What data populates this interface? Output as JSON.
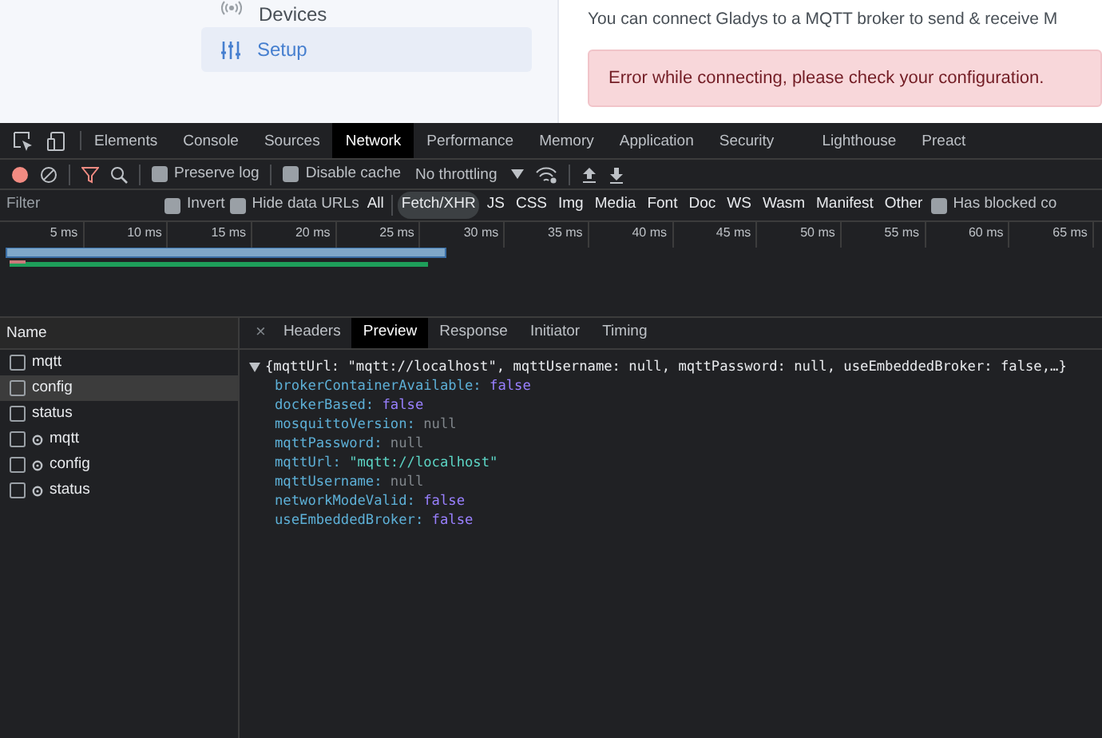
{
  "app": {
    "sidebar": [
      {
        "label": "Devices",
        "selected": false
      },
      {
        "label": "Setup",
        "selected": true
      }
    ],
    "intro": "You can connect Gladys to a MQTT broker to send & receive M",
    "alert": "Error while connecting, please check your configuration."
  },
  "devtools": {
    "tabs": [
      {
        "label": "Elements",
        "selected": false
      },
      {
        "label": "Console",
        "selected": false
      },
      {
        "label": "Sources",
        "selected": false
      },
      {
        "label": "Network",
        "selected": true
      },
      {
        "label": "Performance",
        "selected": false
      },
      {
        "label": "Memory",
        "selected": false
      },
      {
        "label": "Application",
        "selected": false
      },
      {
        "label": "Security",
        "selected": false
      },
      {
        "label": "Lighthouse",
        "selected": false
      },
      {
        "label": "Preact",
        "selected": false
      }
    ],
    "toolbar": {
      "preserve_log": {
        "label": "Preserve log",
        "checked": false
      },
      "disable_cache": {
        "label": "Disable cache",
        "checked": false
      },
      "throttling": "No throttling",
      "filter_on": true
    },
    "filter": {
      "placeholder": "Filter",
      "invert": {
        "label": "Invert",
        "checked": false
      },
      "hide_data_urls": {
        "label": "Hide data URLs",
        "checked": false
      },
      "types": [
        {
          "label": "All",
          "selected": false
        },
        {
          "label": "Fetch/XHR",
          "selected": true
        },
        {
          "label": "JS",
          "selected": false
        },
        {
          "label": "CSS",
          "selected": false
        },
        {
          "label": "Img",
          "selected": false
        },
        {
          "label": "Media",
          "selected": false
        },
        {
          "label": "Font",
          "selected": false
        },
        {
          "label": "Doc",
          "selected": false
        },
        {
          "label": "WS",
          "selected": false
        },
        {
          "label": "Wasm",
          "selected": false
        },
        {
          "label": "Manifest",
          "selected": false
        },
        {
          "label": "Other",
          "selected": false
        }
      ],
      "blocked": {
        "label": "Has blocked co",
        "checked": false
      }
    },
    "timeline_ticks": [
      "5 ms",
      "10 ms",
      "15 ms",
      "20 ms",
      "25 ms",
      "30 ms",
      "35 ms",
      "40 ms",
      "45 ms",
      "50 ms",
      "55 ms",
      "60 ms",
      "65 ms"
    ],
    "requests_header": "Name",
    "requests": [
      {
        "name": "mqtt",
        "kind": "plain",
        "selected": false
      },
      {
        "name": "config",
        "kind": "plain",
        "selected": true
      },
      {
        "name": "status",
        "kind": "plain",
        "selected": false
      },
      {
        "name": "mqtt",
        "kind": "preflight",
        "selected": false
      },
      {
        "name": "config",
        "kind": "preflight",
        "selected": false
      },
      {
        "name": "status",
        "kind": "preflight",
        "selected": false
      }
    ],
    "detail_close": "×",
    "detail_tabs": [
      {
        "label": "Headers",
        "selected": false
      },
      {
        "label": "Preview",
        "selected": true
      },
      {
        "label": "Response",
        "selected": false
      },
      {
        "label": "Initiator",
        "selected": false
      },
      {
        "label": "Timing",
        "selected": false
      }
    ],
    "preview": {
      "summary": "{mqttUrl: \"mqtt://localhost\", mqttUsername: null, mqttPassword: null, useEmbeddedBroker: false,…}",
      "properties": [
        {
          "key": "brokerContainerAvailable:",
          "value": "false",
          "kind": "boolean"
        },
        {
          "key": "dockerBased:",
          "value": "false",
          "kind": "boolean"
        },
        {
          "key": "mosquittoVersion:",
          "value": "null",
          "kind": "null"
        },
        {
          "key": "mqttPassword:",
          "value": "null",
          "kind": "null"
        },
        {
          "key": "mqttUrl:",
          "value": "\"mqtt://localhost\"",
          "kind": "string"
        },
        {
          "key": "mqttUsername:",
          "value": "null",
          "kind": "null"
        },
        {
          "key": "networkModeValid:",
          "value": "false",
          "kind": "boolean"
        },
        {
          "key": "useEmbeddedBroker:",
          "value": "false",
          "kind": "boolean"
        }
      ]
    }
  }
}
